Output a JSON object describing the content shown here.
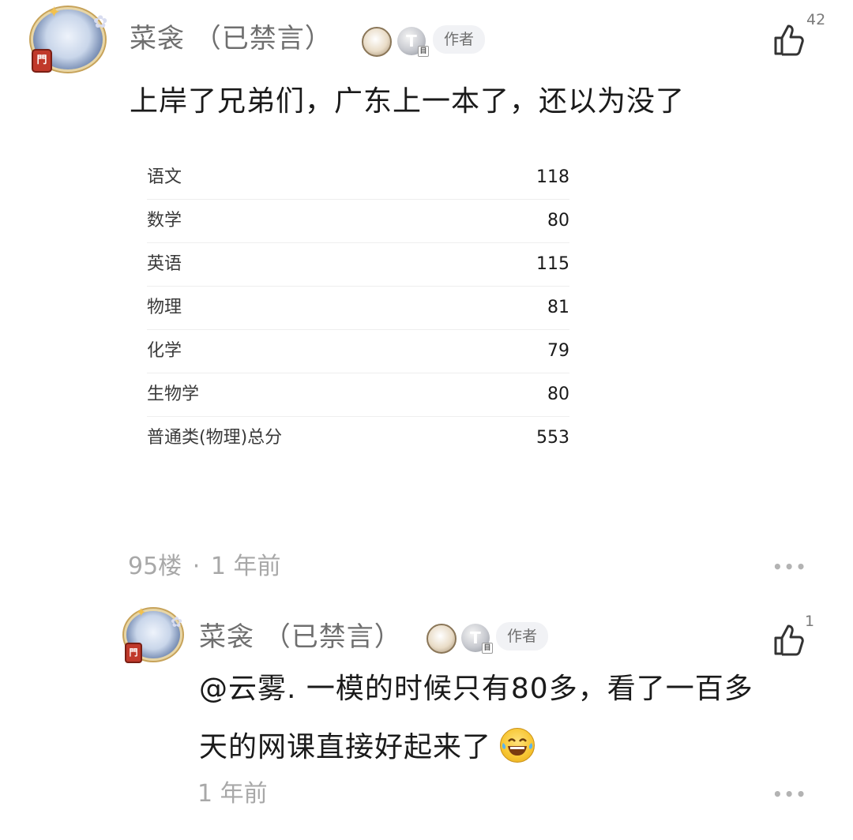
{
  "post": {
    "username": "菜衾 （已禁言）",
    "author_tag": "作者",
    "t_badge": "T",
    "t_badge_sub": "目",
    "avatar_badge": "門",
    "like_count": "42",
    "text": "上岸了兄弟们，广东上一本了，还以为没了",
    "scores": [
      {
        "subject": "语文",
        "score": "118"
      },
      {
        "subject": "数学",
        "score": "80"
      },
      {
        "subject": "英语",
        "score": "115"
      },
      {
        "subject": "物理",
        "score": "81"
      },
      {
        "subject": "化学",
        "score": "79"
      },
      {
        "subject": "生物学",
        "score": "80"
      },
      {
        "subject": "普通类(物理)总分",
        "score": "553"
      }
    ],
    "floor": "95楼",
    "time": "1 年前",
    "meta_separator": "·",
    "more": "•••"
  },
  "reply": {
    "username": "菜衾 （已禁言）",
    "author_tag": "作者",
    "t_badge": "T",
    "t_badge_sub": "目",
    "avatar_badge": "門",
    "like_count": "1",
    "text_line1": "@云雾.  一模的时候只有80多，看了一百多",
    "text_line2": "天的网课直接好起来了",
    "emoji": "grinning-tears-emoji",
    "time": "1 年前",
    "more": "•••"
  },
  "icons": {
    "like": "thumbs-up-icon",
    "more": "more-dots-icon"
  }
}
